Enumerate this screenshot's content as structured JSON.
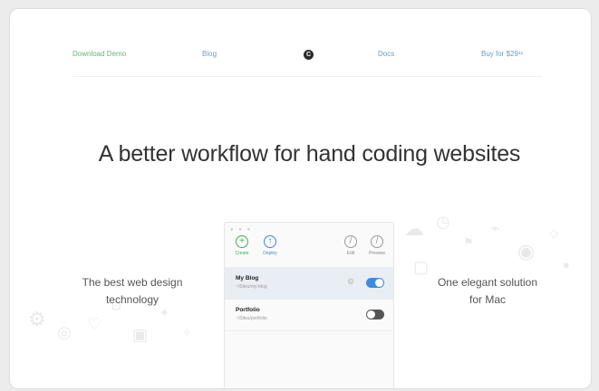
{
  "nav": {
    "download_label": "Download Demo",
    "blog_label": "Blog",
    "logo_glyph": "C",
    "docs_label": "Docs",
    "buy_label": "Buy for $29¹¹"
  },
  "hero": {
    "headline": "A better workflow for hand coding websites",
    "left_text_line1": "The best web design",
    "left_text_line2": "technology",
    "right_text_line1": "One elegant solution",
    "right_text_line2": "for Mac"
  },
  "app": {
    "toolbar": {
      "create_label": "Create",
      "deploy_label": "Deploy",
      "edit_label": "Edit",
      "preview_label": "Preview"
    },
    "sites": [
      {
        "name": "My Blog",
        "path": "~/Sites/my-blog",
        "enabled": true
      },
      {
        "name": "Portfolio",
        "path": "~/Sites/portfolio",
        "enabled": false
      }
    ]
  },
  "colors": {
    "nav_green": "#66b57c",
    "nav_blue": "#6f9ac8",
    "create_green": "#3fae5e",
    "deploy_blue": "#3f86d6",
    "toggle_on": "#3a8de0",
    "toggle_off": "#555555"
  },
  "icons": {
    "logo": "c-logo-icon",
    "create": "plus-circle-icon",
    "deploy": "arrow-up-circle-icon",
    "edit": "pencil-circle-icon",
    "preview": "eye-circle-icon",
    "settings": "gear-icon"
  }
}
